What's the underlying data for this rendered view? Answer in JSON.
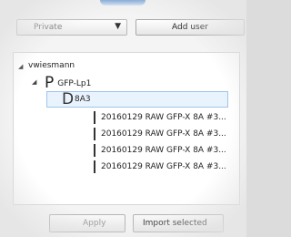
{
  "toolbar": {
    "visibility_select": {
      "value": "Private"
    },
    "add_button_label": "Add user"
  },
  "tree": {
    "user": {
      "label": "vwiesmann",
      "expander": "◢"
    },
    "project": {
      "prefix": "P",
      "label": "GFP-Lp1",
      "expander": "◢"
    },
    "dataset": {
      "prefix": "D",
      "label": "8A3",
      "expander": "◢"
    },
    "files": [
      "20160129 RAW GFP-X 8A #3...",
      "20160129 RAW GFP-X 8A #3...",
      "20160129 RAW GFP-X 8A #3...",
      "20160129 RAW GFP-X 8A #3..."
    ]
  },
  "bottom": {
    "left_button_label": "Apply",
    "import_button_label": "Import selected"
  },
  "colors": {
    "selection_fill": "#e9f3fd",
    "selection_border": "#9fc4ea",
    "accent_glow": "#5b8fd0"
  }
}
